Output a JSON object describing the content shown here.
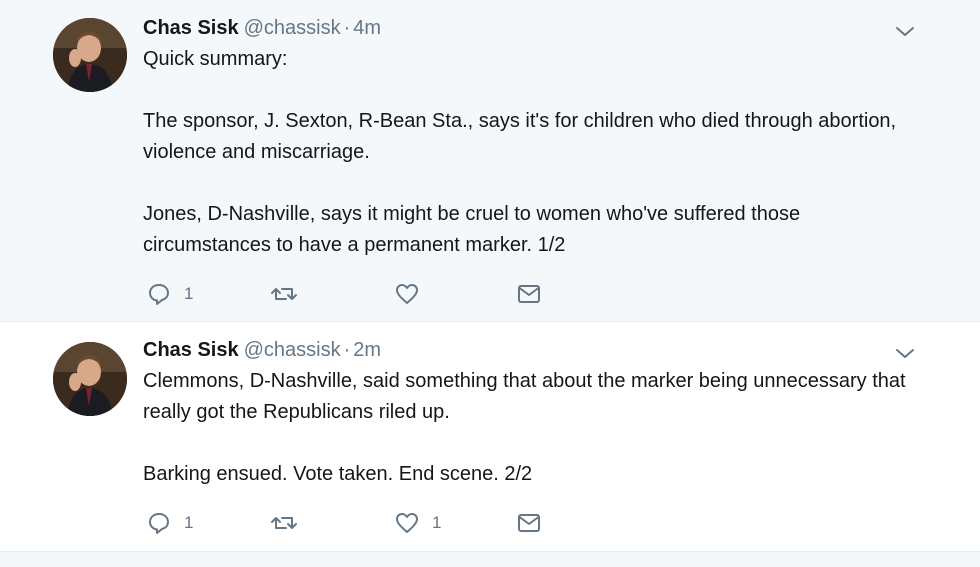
{
  "tweets": [
    {
      "name": "Chas Sisk",
      "handle": "@chassisk",
      "separator": "·",
      "time": "4m",
      "paragraphs": [
        "Quick summary:",
        "The sponsor, J. Sexton, R-Bean Sta., says it's for children who died through abortion, violence and miscarriage.",
        "Jones, D-Nashville, says it might be cruel to women who've suffered those circumstances to have a permanent marker. 1/2"
      ],
      "reply_count": "1",
      "retweet_count": "",
      "like_count": ""
    },
    {
      "name": "Chas Sisk",
      "handle": "@chassisk",
      "separator": "·",
      "time": "2m",
      "paragraphs": [
        "Clemmons, D-Nashville, said something that about the marker being unnecessary that really got the Republicans riled up.",
        "Barking ensued. Vote taken. End scene. 2/2"
      ],
      "reply_count": "1",
      "retweet_count": "",
      "like_count": "1"
    }
  ],
  "icons": {
    "reply": "reply-icon",
    "retweet": "retweet-icon",
    "like": "heart-icon",
    "dm": "envelope-icon",
    "menu": "chevron-down-icon"
  },
  "colors": {
    "thread_line": "#a3d4f7",
    "muted": "#657786",
    "text": "#14171a",
    "tweet_bg_top": "#f5f8fa"
  }
}
